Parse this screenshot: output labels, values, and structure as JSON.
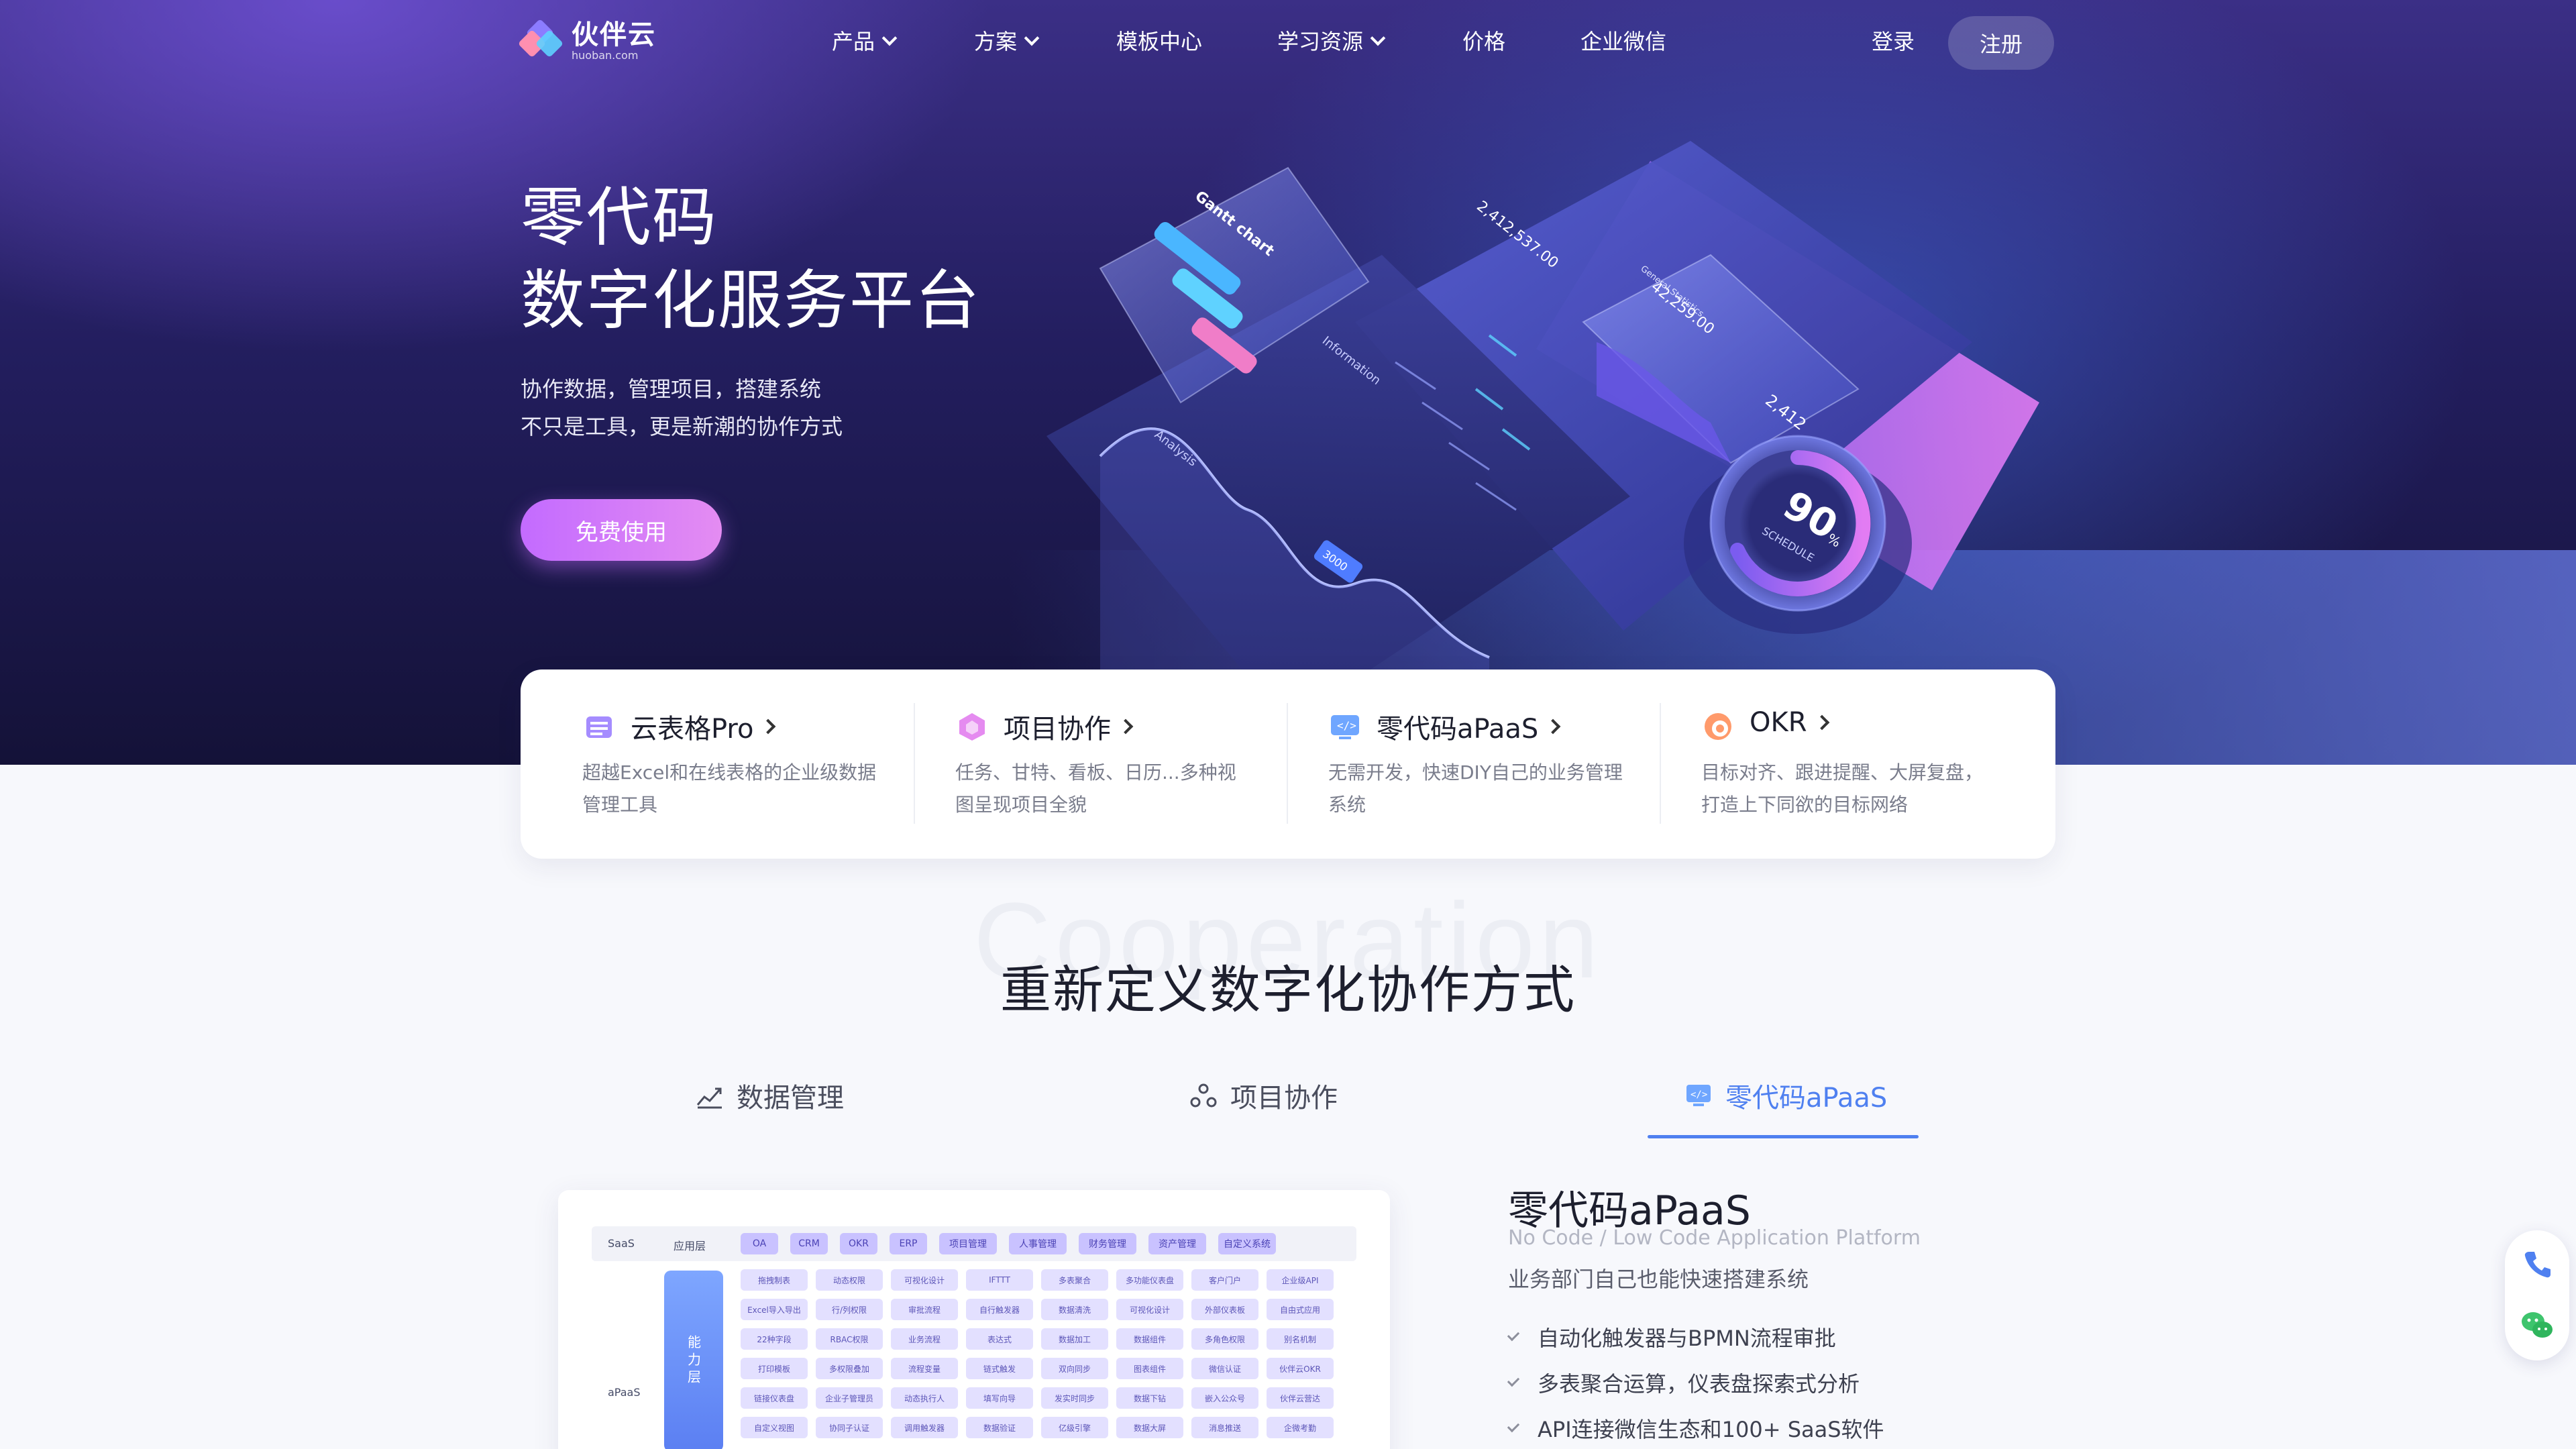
{
  "brand": {
    "name": "伙伴云",
    "domain": "huoban.com"
  },
  "nav": {
    "items": [
      {
        "label": "产品",
        "has_dropdown": true
      },
      {
        "label": "方案",
        "has_dropdown": true
      },
      {
        "label": "模板中心",
        "has_dropdown": false
      },
      {
        "label": "学习资源",
        "has_dropdown": true
      },
      {
        "label": "价格",
        "has_dropdown": false
      },
      {
        "label": "企业微信",
        "has_dropdown": false
      }
    ],
    "login": "登录",
    "signup": "注册"
  },
  "hero": {
    "title_line1": "零代码",
    "title_line2": "数字化服务平台",
    "sub_line1": "协作数据，管理项目，搭建系统",
    "sub_line2": "不只是工具，更是新潮的协作方式",
    "cta": "免费使用",
    "illustration": {
      "gantt": "Gantt chart",
      "total1": "2,412,537.00",
      "general": "General Statistics",
      "total2": "42,259.00",
      "today": "2,412",
      "analysis": "Analysis",
      "info": "Information",
      "badge": "3000",
      "gauge_value": "90",
      "gauge_unit": "%",
      "gauge_label": "SCHEDULE"
    }
  },
  "products": [
    {
      "name": "云表格Pro",
      "desc": "超越Excel和在线表格的企业级数据管理工具",
      "icon": "sheet-icon"
    },
    {
      "name": "项目协作",
      "desc": "任务、甘特、看板、日历...多种视图呈现项目全貌",
      "icon": "project-icon"
    },
    {
      "name": "零代码aPaaS",
      "desc": "无需开发，快速DIY自己的业务管理系统",
      "icon": "code-icon"
    },
    {
      "name": "OKR",
      "desc": "目标对齐、跟进提醒、大屏复盘，打造上下同欲的目标网络",
      "icon": "okr-icon"
    }
  ],
  "section": {
    "bg_word": "Cooperation",
    "title": "重新定义数字化协作方式",
    "tabs": [
      {
        "label": "数据管理",
        "active": false
      },
      {
        "label": "项目协作",
        "active": false
      },
      {
        "label": "零代码aPaaS",
        "active": true
      }
    ]
  },
  "arch": {
    "saas_label": "SaaS",
    "app_layer": "应用层",
    "apaas_label": "aPaaS",
    "ability_layer": "能力层",
    "headers": [
      "OA",
      "CRM",
      "OKR",
      "ERP",
      "项目管理",
      "人事管理",
      "财务管理",
      "资产管理",
      "自定义系统"
    ],
    "rows": [
      [
        "拖拽制表",
        "动态权限",
        "可视化设计",
        "IFTTT",
        "多表聚合",
        "多功能仪表盘",
        "客户门户",
        "企业级API"
      ],
      [
        "Excel导入导出",
        "行/列权限",
        "审批流程",
        "自行触发器",
        "数据清洗",
        "可视化设计",
        "外部仪表板",
        "自由式应用"
      ],
      [
        "22种字段",
        "RBAC权限",
        "业务流程",
        "表达式",
        "数据加工",
        "数据组件",
        "多角色权限",
        "别名机制"
      ],
      [
        "打印模板",
        "多权限叠加",
        "流程变量",
        "链式触发",
        "双向同步",
        "图表组件",
        "微信认证",
        "伙伴云OKR"
      ],
      [
        "链接仪表盘",
        "企业子管理员",
        "动态执行人",
        "填写向导",
        "发实时同步",
        "数据下钻",
        "嵌入公众号",
        "伙伴云营达"
      ],
      [
        "自定义视图",
        "协同子认证",
        "调用触发器",
        "数据验证",
        "亿级引擎",
        "数据大屏",
        "消息推送",
        "企微考勤"
      ]
    ]
  },
  "detail": {
    "title": "零代码aPaaS",
    "subtitle": "No Code / Low Code Application Platform",
    "desc": "业务部门自己也能快速搭建系统",
    "features": [
      "自动化触发器与BPMN流程审批",
      "多表聚合运算，仪表盘探索式分析",
      "API连接微信生态和100+ SaaS软件"
    ]
  },
  "colors": {
    "accent": "#4f80f0",
    "cta_from": "#c36bff",
    "cta_to": "#e48cf2",
    "hero_dark": "#141238"
  }
}
